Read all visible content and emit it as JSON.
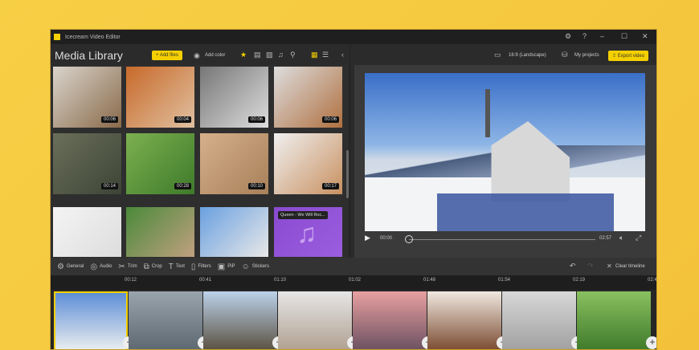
{
  "app": {
    "title": "Icecream Video Editor"
  },
  "header": {
    "library_title": "Media Library",
    "add_files": "Add files",
    "add_color": "Add color",
    "aspect": "16:9 (Landscape)",
    "my_projects": "My projects",
    "export": "Export video"
  },
  "media": [
    {
      "duration": "00:06",
      "colors": [
        "#d9d4cc",
        "#8a6a4a"
      ]
    },
    {
      "duration": "00:04",
      "colors": [
        "#c86a2a",
        "#e0c0a0"
      ]
    },
    {
      "duration": "00:06",
      "colors": [
        "#777",
        "#ddd"
      ]
    },
    {
      "duration": "00:06",
      "colors": [
        "#ddd",
        "#b07040"
      ]
    },
    {
      "duration": "00:14",
      "colors": [
        "#6a6f5a",
        "#3e4436"
      ]
    },
    {
      "duration": "00:28",
      "colors": [
        "#7cb050",
        "#3e7a2a"
      ]
    },
    {
      "duration": "00:10",
      "colors": [
        "#d5b08a",
        "#a8805a"
      ]
    },
    {
      "duration": "00:17",
      "colors": [
        "#f0f0f0",
        "#c89060"
      ]
    },
    {
      "duration": "",
      "colors": [
        "#f4f4f4",
        "#ddd"
      ]
    },
    {
      "duration": "",
      "colors": [
        "#4a8a3a",
        "#c0a080"
      ]
    },
    {
      "duration": "",
      "colors": [
        "#6aa0e0",
        "#e8e8e8"
      ]
    },
    {
      "duration": "",
      "colors": [
        "#8a4ad0",
        "#9b5ee0"
      ],
      "tooltip": "Queen - We Will Roc..."
    }
  ],
  "player": {
    "current": "00:00",
    "total": "02:57"
  },
  "toolbar": [
    "General",
    "Audio",
    "Trim",
    "Crop",
    "Text",
    "Filters",
    "PiP",
    "Stickers"
  ],
  "timeline": {
    "clear": "Clear timeline",
    "ticks": [
      "00:12",
      "00:41",
      "01:10",
      "01:02",
      "01:48",
      "01:54",
      "02:19",
      "02:4"
    ]
  },
  "clips": [
    [
      "#5d8ed6",
      "#e8ecef"
    ],
    [
      "#9aa4ad",
      "#5d6770"
    ],
    [
      "#bcd2ea",
      "#5a5040"
    ],
    [
      "#e6e6e6",
      "#b0a090"
    ],
    [
      "#e8a0a0",
      "#6a5060"
    ],
    [
      "#f0e8e0",
      "#7a4a30"
    ],
    [
      "#d8d8d8",
      "#a0a0a0"
    ],
    [
      "#8ac060",
      "#3e7a2a"
    ]
  ],
  "accent": "#f5d000"
}
